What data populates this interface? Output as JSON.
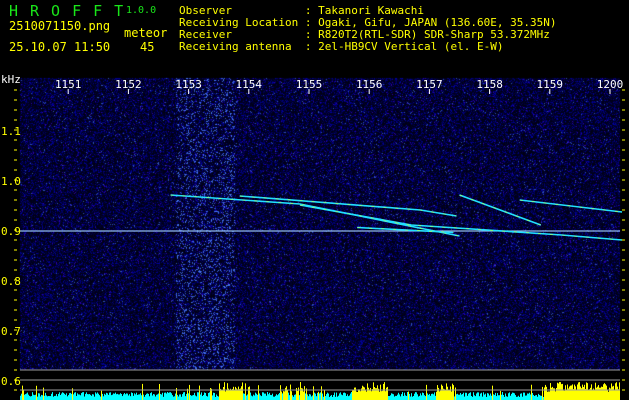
{
  "header": {
    "app_name": "HROFFT",
    "version": "1.0.0",
    "filename": "2510071150.png",
    "datetime": "25.10.07 11:50",
    "meteor_label": "meteor",
    "meteor_count": "45",
    "info": [
      {
        "label": "Observer           :",
        "value": "Takanori Kawachi"
      },
      {
        "label": "Receiving Location :",
        "value": "Ogaki, Gifu, JAPAN (136.60E, 35.35N)"
      },
      {
        "label": "Receiver           :",
        "value": "R820T2(RTL-SDR) SDR-Sharp 53.372MHz"
      },
      {
        "label": "Receiving antenna  :",
        "value": "2el-HB9CV Vertical (el. E-W)"
      }
    ]
  },
  "colors": {
    "text": "#ffff00",
    "logo": "#19e619",
    "background_noise": "#0a0a6e",
    "amplitude_low": "#00ffff",
    "amplitude_high": "#ffff00"
  },
  "chart_data": {
    "type": "heatmap",
    "title": "HROFFT spectrogram",
    "ylabel": "kHz",
    "x_ticks": [
      "1151",
      "1152",
      "1153",
      "1154",
      "1155",
      "1156",
      "1157",
      "1158",
      "1159",
      "1200"
    ],
    "x_range_minutes_after_1150": [
      0,
      10
    ],
    "y_ticks": [
      "1.1",
      "1.0",
      "0.9",
      "0.8",
      "0.7",
      "0.6"
    ],
    "y_range_khz": [
      0.56,
      1.2
    ],
    "carrier_khz": 0.9,
    "meteor_traces": [
      {
        "points": [
          [
            2.7,
            0.97
          ],
          [
            4.85,
            0.952
          ],
          [
            7.5,
            0.888
          ]
        ]
      },
      {
        "points": [
          [
            3.85,
            0.968
          ],
          [
            6.85,
            0.94
          ],
          [
            7.45,
            0.928
          ]
        ]
      },
      {
        "points": [
          [
            4.85,
            0.95
          ],
          [
            6.7,
            0.91
          ],
          [
            9.2,
            0.89
          ],
          [
            10.2,
            0.88
          ]
        ]
      },
      {
        "points": [
          [
            7.5,
            0.97
          ],
          [
            8.85,
            0.91
          ]
        ]
      },
      {
        "points": [
          [
            8.5,
            0.96
          ],
          [
            10.2,
            0.936
          ]
        ]
      },
      {
        "points": [
          [
            5.8,
            0.905
          ],
          [
            7.4,
            0.895
          ]
        ]
      }
    ]
  }
}
